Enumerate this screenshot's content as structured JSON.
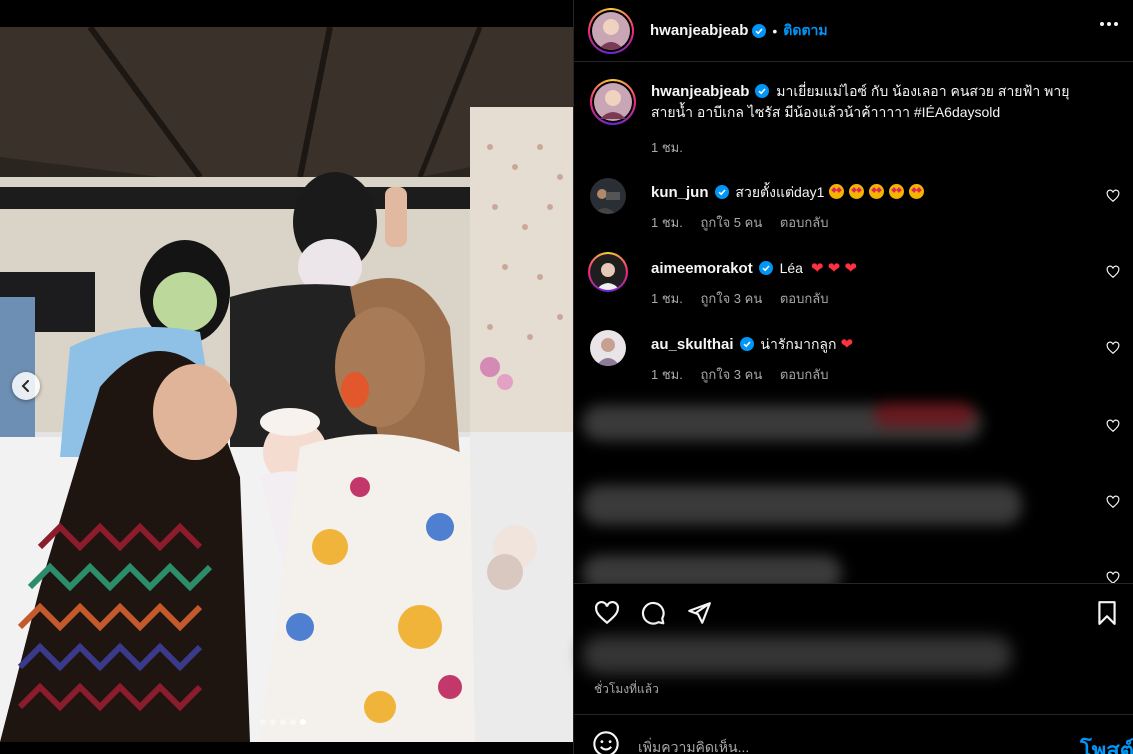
{
  "post": {
    "author": "hwanjeabjeab",
    "follow_label": "ติดตาม",
    "separator": "•",
    "caption_line1": "มาเยี่ยมแม่ไอซ์ กับ น้องเลอา คนสวย สายฟ้า พายุ",
    "caption_line2": "สายน้ำ อาบีเกล ไซรัส มีน้องแล้วน้าค้าาาาา #IÉA6daysold",
    "caption_time": "1 ชม.",
    "carousel_total": 5,
    "carousel_active": 5
  },
  "comments": [
    {
      "username": "kun_jun",
      "text": "สวยตั้งแต่day1",
      "emoji_count": 5,
      "time": "1 ชม.",
      "likes": "ถูกใจ 5 คน",
      "reply": "ตอบกลับ"
    },
    {
      "username": "aimeemorakot",
      "text": "Léa",
      "hearts": "❤ ❤ ❤",
      "time": "1 ชม.",
      "likes": "ถูกใจ 3 คน",
      "reply": "ตอบกลับ"
    },
    {
      "username": "au_skulthai",
      "text": "น่ารักมากลูก",
      "hearts": "❤",
      "time": "1 ชม.",
      "likes": "ถูกใจ 3 คน",
      "reply": "ตอบกลับ"
    }
  ],
  "footer": {
    "time_ago": "ชั่วโมงที่แล้ว",
    "comment_placeholder": "เพิ่มความคิดเห็น...",
    "post_label": "โพสต์"
  },
  "colors": {
    "accent": "#0095f6",
    "background": "#000000",
    "muted": "#a8a8a8",
    "heart": "#ff3040"
  },
  "icons": [
    "chevron-left-icon",
    "more-icon",
    "verified-icon",
    "heart-icon",
    "comment-icon",
    "share-icon",
    "bookmark-icon",
    "emoji-icon"
  ]
}
